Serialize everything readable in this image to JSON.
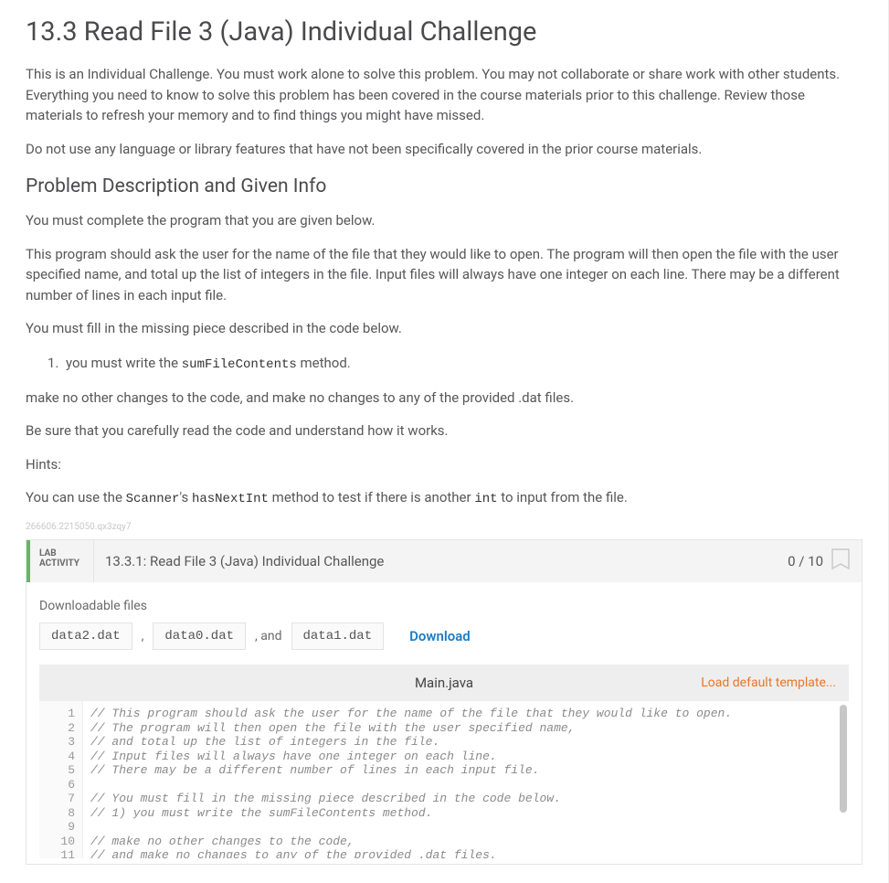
{
  "title": "13.3 Read File 3 (Java) Individual Challenge",
  "intro1": "This is an Individual Challenge. You must work alone to solve this problem. You may not collaborate or share work with other students. Everything you need to know to solve this problem has been covered in the course materials prior to this challenge. Review those materials to refresh your memory and to find things you might have missed.",
  "intro2": "Do not use any language or library features that have not been specifically covered in the prior course materials.",
  "section_header": "Problem Description and Given Info",
  "p1": "You must complete the program that you are given below.",
  "p2": "This program should ask the user for the name of the file that they would like to open. The program will then open the file with the user specified name, and total up the list of integers in the file. Input files will always have one integer on each line. There may be a different number of lines in each input file.",
  "p3": "You must fill in the missing piece described in the code below.",
  "list1_pre": "you must write the ",
  "list1_code": "sumFileContents",
  "list1_post": " method.",
  "p4": "make no other changes to the code, and make no changes to any of the provided .dat files.",
  "p5": "Be sure that you carefully read the code and understand how it works.",
  "hints_label": "Hints:",
  "hint_pre": "You can use the ",
  "hint_c1": "Scanner",
  "hint_mid1": "'s ",
  "hint_c2": "hasNextInt",
  "hint_mid2": " method to test if there is another ",
  "hint_c3": "int",
  "hint_post": " to input from the file.",
  "watermark": "266606.2215050.qx3zqy7",
  "lab": {
    "badge_line1": "LAB",
    "badge_line2": "ACTIVITY",
    "title": "13.3.1: Read File 3 (Java) Individual Challenge",
    "score": "0 / 10"
  },
  "downloads": {
    "label": "Downloadable files",
    "files": [
      "data2.dat",
      "data0.dat",
      "data1.dat"
    ],
    "sep1": ",",
    "sep2": ", and",
    "link": "Download"
  },
  "editor": {
    "filename": "Main.java",
    "load_template": "Load default template...",
    "gutter": "1\n2\n3\n4\n5\n6\n7\n8\n9\n10\n11",
    "code": "// This program should ask the user for the name of the file that they would like to open.\n// The program will then open the file with the user specified name,\n// and total up the list of integers in the file.\n// Input files will always have one integer on each line.\n// There may be a different number of lines in each input file.\n\n// You must fill in the missing piece described in the code below.\n// 1) you must write the sumFileContents method.\n\n// make no other changes to the code,\n// and make no changes to any of the provided .dat files."
  }
}
